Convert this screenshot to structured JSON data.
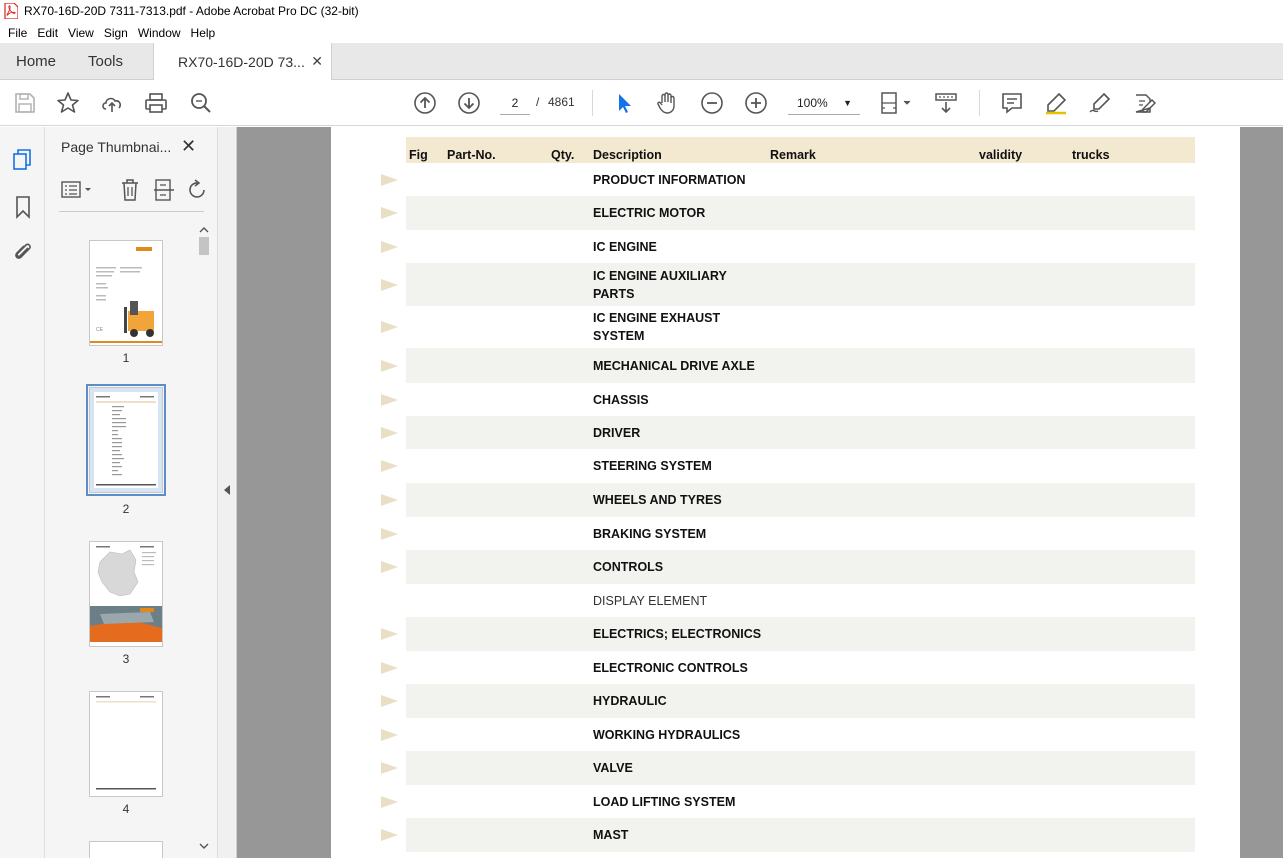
{
  "window": {
    "title": "RX70-16D-20D  7311-7313.pdf - Adobe Acrobat Pro DC (32-bit)"
  },
  "menu": [
    "File",
    "Edit",
    "View",
    "Sign",
    "Window",
    "Help"
  ],
  "tabs": {
    "home": "Home",
    "tools": "Tools",
    "document": "RX70-16D-20D  73..."
  },
  "toolbar": {
    "current_page": "2",
    "page_separator": "/",
    "total_pages": "4861",
    "zoom": "100%"
  },
  "thumbnails_panel": {
    "title": "Page Thumbnai...",
    "pages": [
      "1",
      "2",
      "3",
      "4"
    ],
    "selected_page": "2"
  },
  "table": {
    "headers": {
      "fig": "Fig",
      "part_no": "Part-No.",
      "qty": "Qty.",
      "description": "Description",
      "remark": "Remark",
      "validity": "validity",
      "trucks": "trucks"
    },
    "rows": [
      {
        "desc": "PRODUCT INFORMATION",
        "link": true
      },
      {
        "desc": "ELECTRIC MOTOR",
        "link": true
      },
      {
        "desc": "IC ENGINE",
        "link": true
      },
      {
        "desc": "IC ENGINE AUXILIARY PARTS",
        "line1": "IC ENGINE AUXILIARY",
        "line2": "PARTS",
        "link": true
      },
      {
        "desc": "IC ENGINE EXHAUST SYSTEM",
        "line1": "IC ENGINE EXHAUST",
        "line2": "SYSTEM",
        "link": true
      },
      {
        "desc": "MECHANICAL DRIVE AXLE",
        "link": true
      },
      {
        "desc": "CHASSIS",
        "link": true
      },
      {
        "desc": "DRIVER",
        "link": true
      },
      {
        "desc": "STEERING SYSTEM",
        "link": true
      },
      {
        "desc": "WHEELS AND TYRES",
        "link": true
      },
      {
        "desc": "BRAKING SYSTEM",
        "link": true
      },
      {
        "desc": "CONTROLS",
        "link": true
      },
      {
        "desc": "DISPLAY ELEMENT",
        "link": false
      },
      {
        "desc": "ELECTRICS; ELECTRONICS",
        "link": true
      },
      {
        "desc": "ELECTRONIC CONTROLS",
        "link": true
      },
      {
        "desc": "HYDRAULIC",
        "link": true
      },
      {
        "desc": "WORKING HYDRAULICS",
        "link": true
      },
      {
        "desc": "VALVE",
        "link": true
      },
      {
        "desc": "LOAD LIFTING SYSTEM",
        "link": true
      },
      {
        "desc": "MAST",
        "link": true
      }
    ]
  },
  "colors": {
    "header_bg": "#f3e8d0",
    "row_shade": "#f2f2ef",
    "arrow": "#e8dfc4",
    "doc_bg": "#979797",
    "select_blue": "#1473e6"
  }
}
